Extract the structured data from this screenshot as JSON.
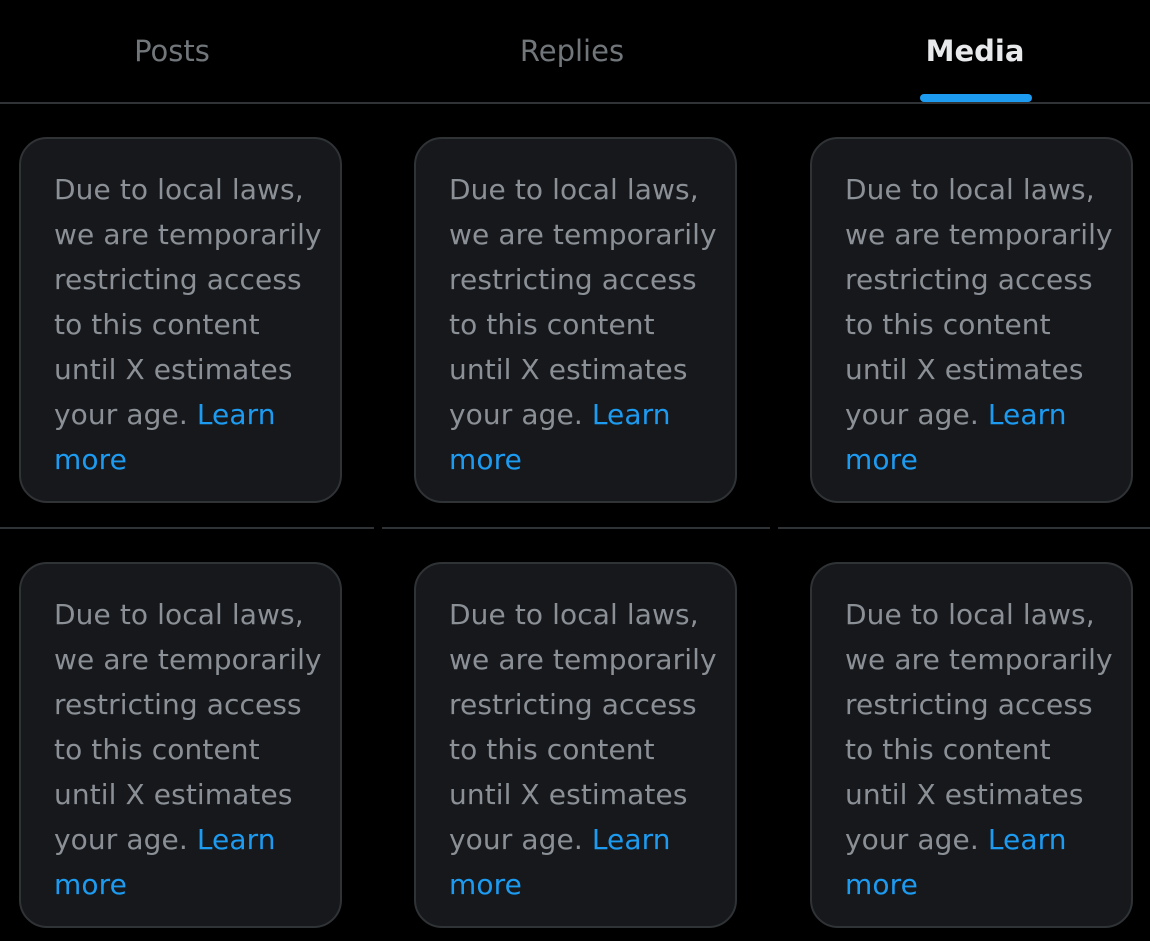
{
  "tabs": [
    {
      "label": "Posts",
      "active": false
    },
    {
      "label": "Replies",
      "active": false
    },
    {
      "label": "Media",
      "active": true
    }
  ],
  "notice": {
    "text": "Due to local laws, we are temporarily restricting access to this content until X estimates your age.",
    "link_label": "Learn more"
  },
  "media_items": [
    {
      "text": "Due to local laws, we are temporarily restricting access to this content until X estimates your age.",
      "link_label": "Learn more"
    },
    {
      "text": "Due to local laws, we are temporarily restricting access to this content until X estimates your age.",
      "link_label": "Learn more"
    },
    {
      "text": "Due to local laws, we are temporarily restricting access to this content until X estimates your age.",
      "link_label": "Learn more"
    },
    {
      "text": "Due to local laws, we are temporarily restricting access to this content until X estimates your age.",
      "link_label": "Learn more"
    },
    {
      "text": "Due to local laws, we are temporarily restricting access to this content until X estimates your age.",
      "link_label": "Learn more"
    },
    {
      "text": "Due to local laws, we are temporarily restricting access to this content until X estimates your age.",
      "link_label": "Learn more"
    }
  ],
  "colors": {
    "background": "#000000",
    "card_background": "#16181c",
    "muted_text": "#8b9096",
    "link": "#1d9bf0",
    "active_tab": "#e7e9ea"
  }
}
